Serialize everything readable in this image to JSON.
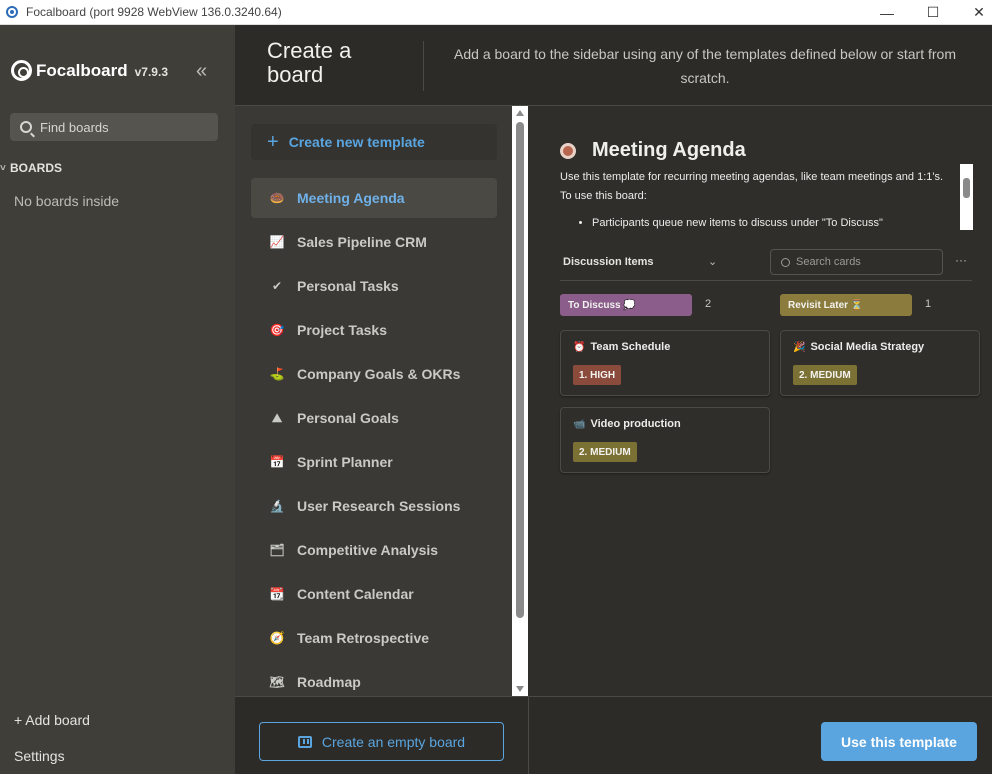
{
  "window": {
    "title": "Focalboard (port 9928 WebView 136.0.3240.64)",
    "controls": [
      "—",
      "☐",
      "✕"
    ]
  },
  "sidebar": {
    "app_name": "Focalboard",
    "version": "v7.9.3",
    "collapse_glyph": "«",
    "find_placeholder": "Find boards",
    "boards_header": "BOARDS",
    "boards_chevron": "˅",
    "empty_text": "No boards inside",
    "add_board": "+ Add board",
    "settings": "Settings"
  },
  "dialog": {
    "title": "Create a board",
    "description": "Add a board to the sidebar using any of the templates defined below or start from scratch.",
    "create_new_template": "Create new template",
    "templates": [
      {
        "icon": "🍩",
        "label": "Meeting Agenda",
        "active": true
      },
      {
        "icon": "📈",
        "label": "Sales Pipeline CRM"
      },
      {
        "icon": "✔",
        "label": "Personal Tasks"
      },
      {
        "icon": "🎯",
        "label": "Project Tasks"
      },
      {
        "icon": "⛳",
        "label": "Company Goals & OKRs"
      },
      {
        "icon": "⛰",
        "label": "Personal Goals"
      },
      {
        "icon": "📅",
        "label": "Sprint Planner"
      },
      {
        "icon": "🔬",
        "label": "User Research Sessions"
      },
      {
        "icon": "🗂",
        "label": "Competitive Analysis"
      },
      {
        "icon": "📆",
        "label": "Content Calendar"
      },
      {
        "icon": "🧭",
        "label": "Team Retrospective"
      },
      {
        "icon": "🗺",
        "label": "Roadmap"
      }
    ],
    "preview": {
      "title": "Meeting Agenda",
      "description_line1": "Use this template for recurring meeting agendas, like team meetings and 1:1's.",
      "description_line2": "To use this board:",
      "bullet1": "Participants queue new items to discuss under \"To Discuss\"",
      "view_name": "Discussion Items",
      "view_chevron": "⌄",
      "search_placeholder": "Search cards",
      "more": "···",
      "columns": [
        {
          "label": "To Discuss 💭",
          "count": "2",
          "color": "#8a5d8b"
        },
        {
          "label": "Revisit Later ⏳",
          "count": "1",
          "color": "#8b7c3e"
        }
      ],
      "cards": [
        {
          "icon": "⏰",
          "title": "Team Schedule",
          "badge": "1. HIGH",
          "badge_color": "#8a4a3c"
        },
        {
          "icon": "🎉",
          "title": "Social Media Strategy",
          "badge": "2. MEDIUM",
          "badge_color": "#7c7135"
        },
        {
          "icon": "📹",
          "title": "Video production",
          "badge": "2. MEDIUM",
          "badge_color": "#7c7135"
        }
      ]
    },
    "empty_board_button": "Create an empty board",
    "use_template_button": "Use this template"
  }
}
